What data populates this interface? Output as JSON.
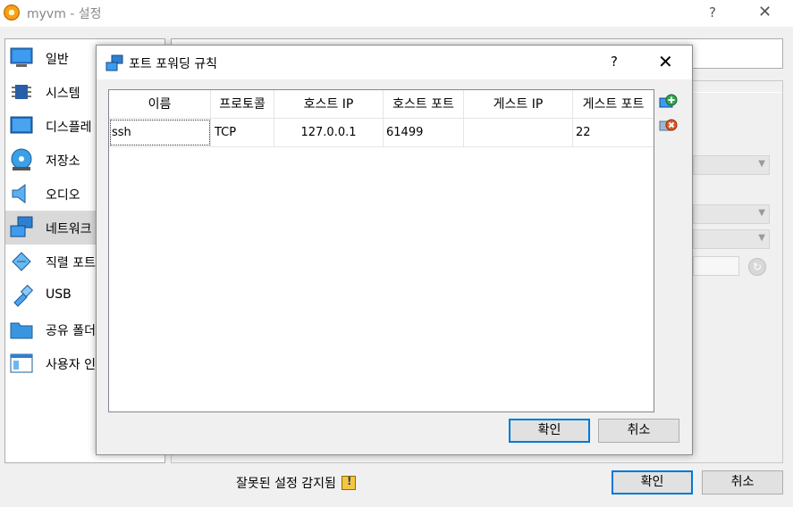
{
  "window": {
    "title": "myvm - 설정",
    "help": "?",
    "close": "✕"
  },
  "sidebar": {
    "items": [
      {
        "label": "일반",
        "icon": "general-icon"
      },
      {
        "label": "시스템",
        "icon": "system-icon"
      },
      {
        "label": "디스플레",
        "icon": "display-icon"
      },
      {
        "label": "저장소",
        "icon": "storage-icon"
      },
      {
        "label": "오디오",
        "icon": "audio-icon"
      },
      {
        "label": "네트워크",
        "icon": "network-icon",
        "selected": true
      },
      {
        "label": "직렬 포트",
        "icon": "serial-ports-icon"
      },
      {
        "label": "USB",
        "icon": "usb-icon"
      },
      {
        "label": "공유 폴더",
        "icon": "shared-folders-icon"
      },
      {
        "label": "사용자 인",
        "icon": "user-interface-icon"
      }
    ]
  },
  "footer": {
    "warning": "잘못된 설정 감지됨",
    "ok": "확인",
    "cancel": "취소"
  },
  "dialog": {
    "title": "포트 포워딩 규칙",
    "help": "?",
    "close": "✕",
    "columns": [
      "이름",
      "프로토콜",
      "호스트 IP",
      "호스트 포트",
      "게스트 IP",
      "게스트 포트"
    ],
    "rows": [
      {
        "name": "ssh",
        "protocol": "TCP",
        "host_ip": "127.0.0.1",
        "host_port": "61499",
        "guest_ip": "",
        "guest_port": "22"
      }
    ],
    "ok": "확인",
    "cancel": "취소",
    "add_icon": "add-rule-icon",
    "remove_icon": "remove-rule-icon"
  },
  "colors": {
    "accent": "#0078d7",
    "selected": "#d9d9d9"
  }
}
